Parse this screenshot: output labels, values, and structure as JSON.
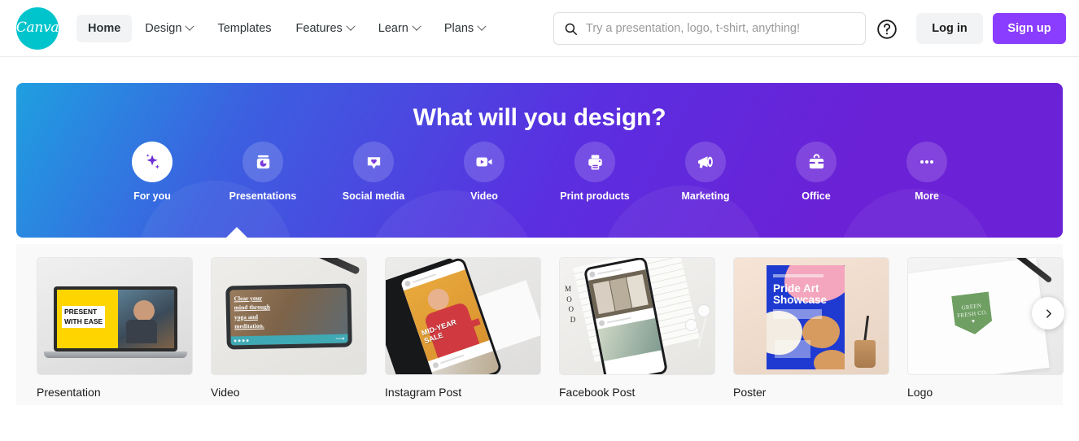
{
  "header": {
    "logo": {
      "text": "Canva",
      "icon": "canva-logo-icon",
      "color": "#00c4cc"
    },
    "nav": [
      {
        "label": "Home",
        "active": true,
        "has_chevron": false
      },
      {
        "label": "Design",
        "active": false,
        "has_chevron": true
      },
      {
        "label": "Templates",
        "active": false,
        "has_chevron": false
      },
      {
        "label": "Features",
        "active": false,
        "has_chevron": true
      },
      {
        "label": "Learn",
        "active": false,
        "has_chevron": true
      },
      {
        "label": "Plans",
        "active": false,
        "has_chevron": true
      }
    ],
    "search": {
      "placeholder": "Try a presentation, logo, t-shirt, anything!",
      "value": "",
      "icon": "search-icon"
    },
    "help_icon": "question-mark-circle-icon",
    "login_label": "Log in",
    "signup_label": "Sign up",
    "signup_color": "#8b3dff"
  },
  "hero": {
    "title": "What will you design?",
    "gradient_from": "#1f9fe0",
    "gradient_to": "#6b21d6",
    "categories": [
      {
        "label": "For you",
        "icon": "sparkle-icon",
        "active": true
      },
      {
        "label": "Presentations",
        "icon": "presentation-icon",
        "active": false
      },
      {
        "label": "Social media",
        "icon": "heart-bubble-icon",
        "active": false
      },
      {
        "label": "Video",
        "icon": "video-camera-icon",
        "active": false
      },
      {
        "label": "Print products",
        "icon": "printer-icon",
        "active": false
      },
      {
        "label": "Marketing",
        "icon": "megaphone-icon",
        "active": false
      },
      {
        "label": "Office",
        "icon": "briefcase-icon",
        "active": false
      },
      {
        "label": "More",
        "icon": "ellipsis-icon",
        "active": false
      }
    ]
  },
  "cards": {
    "items": [
      {
        "label": "Presentation",
        "art": "presentation",
        "slide_text": "PRESENT\nWITH EASE"
      },
      {
        "label": "Video",
        "art": "video",
        "slide_text": "Clear your mind through yoga and meditation."
      },
      {
        "label": "Instagram Post",
        "art": "instagram",
        "slide_text": "MID-YEAR SALE"
      },
      {
        "label": "Facebook Post",
        "art": "facebook",
        "slide_text": "MOOD"
      },
      {
        "label": "Poster",
        "art": "poster",
        "slide_text": "Pride Art Showcase"
      },
      {
        "label": "Logo",
        "art": "logo",
        "slide_text": "GREEN FRESH CO."
      }
    ],
    "next_icon": "chevron-right-icon"
  }
}
